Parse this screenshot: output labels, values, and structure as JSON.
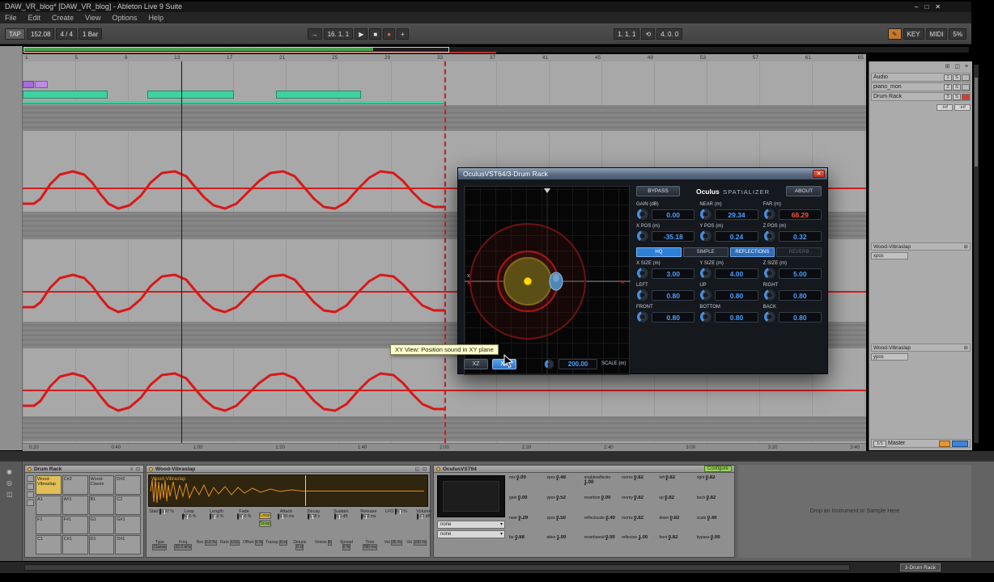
{
  "titlebar": {
    "title": "DAW_VR_blog* [DAW_VR_blog] - Ableton Live 9 Suite",
    "minimize": "–",
    "maximize": "□",
    "close": "✕"
  },
  "menu": {
    "items": [
      "File",
      "Edit",
      "Create",
      "View",
      "Options",
      "Help"
    ]
  },
  "transport": {
    "tap": "TAP",
    "tempo": "152.08",
    "signature": "4 / 4",
    "metro": "1 Bar",
    "follow": "→",
    "position": "16. 1. 1",
    "play": "▶",
    "stop": "■",
    "record": "●",
    "overdub": "+",
    "loop_start": "1. 1. 1",
    "loop": "⟲",
    "loop_length": "4. 0. 0",
    "draw": "✎",
    "key": "KEY",
    "midi": "MIDI",
    "cpu": "5%"
  },
  "ruler": {
    "labels": [
      "1",
      "5",
      "9",
      "13",
      "17",
      "21",
      "25",
      "29",
      "33",
      "37",
      "41",
      "45",
      "49",
      "53",
      "57",
      "61",
      "65"
    ]
  },
  "tracks": {
    "rows": [
      {
        "num": "1",
        "name": "Audio",
        "solo": "S",
        "arm_color": "#b8b8b8"
      },
      {
        "num": "2",
        "name": "piano_mon",
        "solo": "S",
        "arm_color": "#b8b8b8"
      },
      {
        "num": "3",
        "name": "Drum Rack",
        "solo": "S",
        "arm_color": "#d0402e"
      }
    ],
    "meters": [
      "-inf",
      "-inf"
    ],
    "lanes": [
      {
        "name": "Wood-Vibraslap",
        "collapse": "⊖",
        "param": "xpos"
      },
      {
        "name": "Wood-Vibraslap",
        "collapse": "⊖",
        "param": "ypos"
      }
    ],
    "master": {
      "ratio": "1/1",
      "label": "Master"
    }
  },
  "time_ruler": {
    "labels": [
      "0:20",
      "0:40",
      "1:00",
      "1:20",
      "1:40",
      "2:00",
      "2:20",
      "2:40",
      "3:00",
      "3:20",
      "3:40"
    ]
  },
  "plugin": {
    "title": "OculusVST64/3-Drum Rack",
    "close": "✕",
    "bypass": "BYPASS",
    "brand": "Oculus",
    "brand_sub": "SPATIALIZER",
    "about": "ABOUT",
    "axis_label": "x",
    "params_top": [
      {
        "label": "GAIN (dB)",
        "value": "0.00",
        "color": "#4da0ff"
      },
      {
        "label": "NEAR (m)",
        "value": "29.34",
        "color": "#4da0ff"
      },
      {
        "label": "FAR (m)",
        "value": "68.29",
        "color": "#ff4b38"
      },
      {
        "label": "X POS (m)",
        "value": "-35.18",
        "color": "#4da0ff"
      },
      {
        "label": "Y POS (m)",
        "value": "0.24",
        "color": "#4da0ff"
      },
      {
        "label": "Z POS (m)",
        "value": "0.32",
        "color": "#4da0ff"
      }
    ],
    "tabs": [
      {
        "label": "HQ",
        "bg": "#2e7fd6",
        "fg": "#ffffff",
        "border": "#7ab2f0"
      },
      {
        "label": "SIMPLE",
        "bg": "#262c35",
        "fg": "#c2cbd6",
        "border": "#4a5464"
      },
      {
        "label": "REFLECTIONS",
        "bg": "#2e6db8",
        "fg": "#ffffff",
        "border": "#6aa2e0"
      },
      {
        "label": "REVERB",
        "bg": "#1b2026",
        "fg": "#5a6470",
        "border": "#343c46"
      }
    ],
    "params_bottom": [
      {
        "label": "X SIZE (m)",
        "value": "3.00",
        "color": "#4da0ff"
      },
      {
        "label": "Y SIZE (m)",
        "value": "4.00",
        "color": "#4da0ff"
      },
      {
        "label": "Z SIZE (m)",
        "value": "5.00",
        "color": "#4da0ff"
      },
      {
        "label": "LEFT",
        "value": "0.80",
        "color": "#4da0ff"
      },
      {
        "label": "UP",
        "value": "0.80",
        "color": "#4da0ff"
      },
      {
        "label": "RIGHT",
        "value": "0.80",
        "color": "#4da0ff"
      },
      {
        "label": "FRONT",
        "value": "0.80",
        "color": "#4da0ff"
      },
      {
        "label": "BOTTOM",
        "value": "0.80",
        "color": "#4da0ff"
      },
      {
        "label": "BACK",
        "value": "0.80",
        "color": "#4da0ff"
      }
    ],
    "footer": {
      "xz": "XZ",
      "xy": "XY",
      "scale_value": "200.00",
      "scale_label": "SCALE (m)"
    }
  },
  "tooltip": {
    "text": "XY View: Position sound in XY plane"
  },
  "drum_rack": {
    "title": "Drum Rack",
    "pads": [
      {
        "label": "Wood-Vibraslap",
        "bg": "#e2bf55"
      },
      {
        "label": "C#2",
        "bg": "#9c9c9c"
      },
      {
        "label": "Wood-Claves",
        "bg": "#9c9c9c"
      },
      {
        "label": "D#2",
        "bg": "#9c9c9c"
      },
      {
        "label": "A1",
        "bg": "#9c9c9c"
      },
      {
        "label": "A#1",
        "bg": "#9c9c9c"
      },
      {
        "label": "B1",
        "bg": "#9c9c9c"
      },
      {
        "label": "C2",
        "bg": "#9c9c9c"
      },
      {
        "label": "F1",
        "bg": "#9c9c9c"
      },
      {
        "label": "F#1",
        "bg": "#9c9c9c"
      },
      {
        "label": "G1",
        "bg": "#9c9c9c"
      },
      {
        "label": "G#1",
        "bg": "#9c9c9c"
      },
      {
        "label": "C1",
        "bg": "#9c9c9c"
      },
      {
        "label": "C#1",
        "bg": "#9c9c9c"
      },
      {
        "label": "D1",
        "bg": "#9c9c9c"
      },
      {
        "label": "D#1",
        "bg": "#9c9c9c"
      }
    ]
  },
  "simpler": {
    "title": "Wood-Vibraslap",
    "wave_text": "Wood-Vibraslap",
    "knobs_a": [
      {
        "label": "Start",
        "value": "3.97 %"
      },
      {
        "label": "Loop",
        "value": "82.5 %"
      },
      {
        "label": "Length",
        "value": "15.9 %"
      },
      {
        "label": "Fade",
        "value": "18.0 %"
      }
    ],
    "knobs_b": [
      {
        "label": "Attack",
        "value": "0.00 ms"
      },
      {
        "label": "Decay",
        "value": "2.38 s"
      },
      {
        "label": "Sustain",
        "value": "0.0 dB"
      },
      {
        "label": "Release",
        "value": "632 ms"
      },
      {
        "label": "LFO",
        "value": "0.0 %"
      },
      {
        "label": "Volume",
        "value": "-12 dB"
      }
    ],
    "toggles": [
      {
        "label": "Loop",
        "bg": "#d8b830"
      },
      {
        "label": "Snap",
        "bg": "#8cbc50"
      }
    ],
    "fields": [
      {
        "label": "Type",
        "value": "Classic"
      },
      {
        "label": "Freq",
        "value": "22.0 kHz"
      },
      {
        "label": "Res",
        "value": "0.0 %"
      },
      {
        "label": "Rate",
        "value": "1/16"
      },
      {
        "label": "Offset",
        "value": "0 %"
      },
      {
        "label": "Transp",
        "value": "0 st"
      },
      {
        "label": "Detune",
        "value": "0 ct"
      },
      {
        "label": "Voices",
        "value": "8"
      },
      {
        "label": "Spread",
        "value": "0 %"
      },
      {
        "label": "Time",
        "value": "780 ms"
      },
      {
        "label": "Vel",
        "value": "35 %"
      },
      {
        "label": "Vol",
        "value": "100 %"
      }
    ]
  },
  "oculus_device": {
    "title": "OculusVST64",
    "configure": "Configure",
    "dropdowns": [
      "none",
      "none"
    ],
    "params": [
      {
        "name": "mix",
        "value": "0.00"
      },
      {
        "name": "xpos",
        "value": "0.48"
      },
      {
        "name": "enablereflectio",
        "value": "1.00"
      },
      {
        "name": "roomx",
        "value": "0.82"
      },
      {
        "name": "left",
        "value": "0.82"
      },
      {
        "name": "right",
        "value": "0.82"
      },
      {
        "name": "gain",
        "value": "0.00"
      },
      {
        "name": "ypos",
        "value": "0.52"
      },
      {
        "name": "reverbon",
        "value": "0.00"
      },
      {
        "name": "roomy",
        "value": "0.82"
      },
      {
        "name": "up",
        "value": "0.82"
      },
      {
        "name": "back",
        "value": "0.82"
      },
      {
        "name": "near",
        "value": "0.29"
      },
      {
        "name": "zpos",
        "value": "0.50"
      },
      {
        "name": "reflectscale",
        "value": "0.40"
      },
      {
        "name": "roomz",
        "value": "0.82"
      },
      {
        "name": "down",
        "value": "0.82"
      },
      {
        "name": "scale",
        "value": "0.40"
      },
      {
        "name": "far",
        "value": "0.68"
      },
      {
        "name": "atten",
        "value": "1.00"
      },
      {
        "name": "reverbsend",
        "value": "0.00"
      },
      {
        "name": "reflecton",
        "value": "1.00"
      },
      {
        "name": "front",
        "value": "0.82"
      },
      {
        "name": "bypass",
        "value": "0.00"
      }
    ]
  },
  "drop_area": {
    "text": "Drop an Instrument or Sample Here"
  },
  "status": {
    "chip": "3-Drum Rack"
  }
}
